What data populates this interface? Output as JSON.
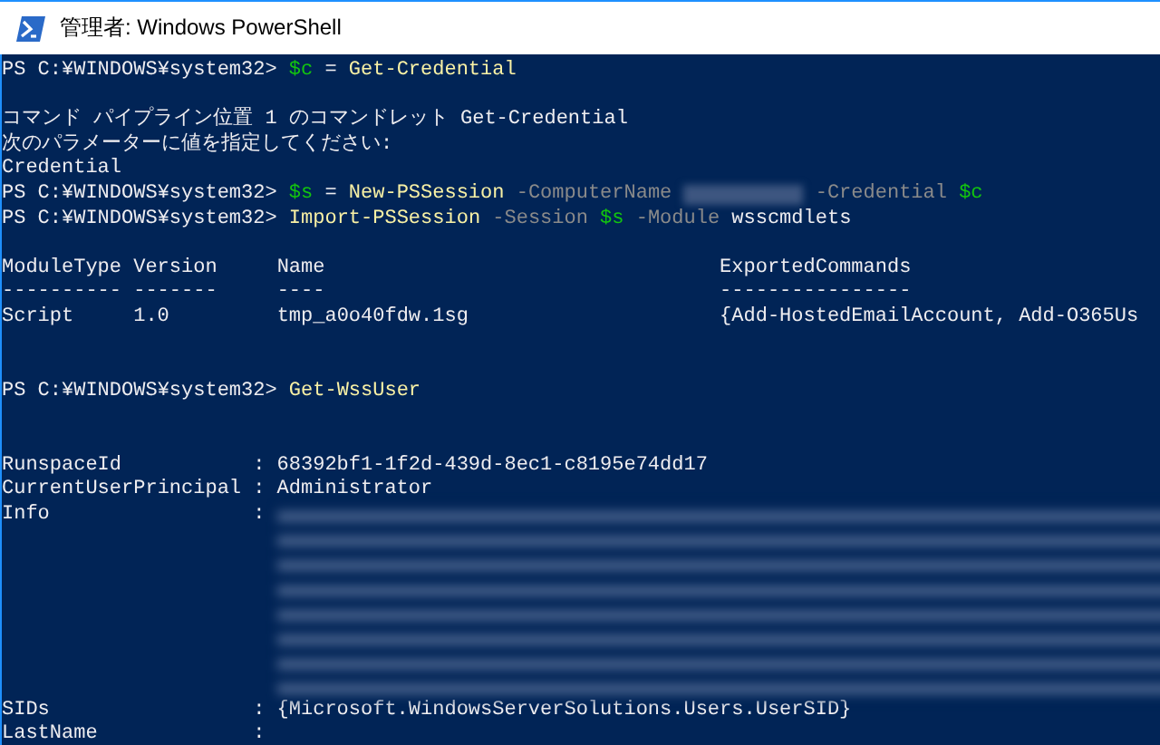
{
  "window": {
    "title": "管理者: Windows PowerShell"
  },
  "console": [
    {
      "kind": "line",
      "segments": [
        {
          "kind": "prompt",
          "text": "PS C:¥WINDOWS¥system32>"
        },
        {
          "kind": "var",
          "text": "$c"
        },
        {
          "kind": "text",
          "text": "="
        },
        {
          "kind": "cmd",
          "text": "Get-Credential"
        }
      ]
    },
    {
      "kind": "blank"
    },
    {
      "kind": "line",
      "segments": [
        {
          "kind": "text",
          "text": "コマンド パイプライン位置 1 のコマンドレット Get-Credential"
        }
      ]
    },
    {
      "kind": "line",
      "segments": [
        {
          "kind": "text",
          "text": "次のパラメーターに値を指定してください:"
        }
      ]
    },
    {
      "kind": "line",
      "segments": [
        {
          "kind": "text",
          "text": "Credential"
        }
      ]
    },
    {
      "kind": "line",
      "segments": [
        {
          "kind": "prompt",
          "text": "PS C:¥WINDOWS¥system32>"
        },
        {
          "kind": "var",
          "text": "$s"
        },
        {
          "kind": "text",
          "text": "="
        },
        {
          "kind": "cmd",
          "text": "New-PSSession"
        },
        {
          "kind": "param",
          "text": "-ComputerName"
        },
        {
          "kind": "redacted"
        },
        {
          "kind": "param",
          "text": "-Credential"
        },
        {
          "kind": "var",
          "text": "$c"
        }
      ]
    },
    {
      "kind": "line",
      "segments": [
        {
          "kind": "prompt",
          "text": "PS C:¥WINDOWS¥system32>"
        },
        {
          "kind": "cmd",
          "text": "Import-PSSession"
        },
        {
          "kind": "param",
          "text": "-Session"
        },
        {
          "kind": "var",
          "text": "$s"
        },
        {
          "kind": "param",
          "text": "-Module"
        },
        {
          "kind": "text",
          "text": "wsscmdlets"
        }
      ]
    },
    {
      "kind": "blank"
    },
    {
      "kind": "table",
      "columns": [
        "ModuleType",
        "Version",
        "Name",
        "ExportedCommands"
      ],
      "rules": [
        "----------",
        "-------",
        "----",
        "----------------"
      ],
      "rows": [
        [
          "Script",
          "1.0",
          "tmp_a0o40fdw.1sg",
          "{Add-HostedEmailAccount, Add-O365Us"
        ]
      ]
    },
    {
      "kind": "blank"
    },
    {
      "kind": "blank"
    },
    {
      "kind": "line",
      "segments": [
        {
          "kind": "prompt",
          "text": "PS C:¥WINDOWS¥system32>"
        },
        {
          "kind": "cmd",
          "text": "Get-WssUser"
        }
      ]
    },
    {
      "kind": "blank"
    },
    {
      "kind": "blank"
    },
    {
      "kind": "properties",
      "items": [
        {
          "name": "RunspaceId",
          "separator": ":",
          "kind": "text",
          "value": "68392bf1-1f2d-439d-8ec1-c8195e74dd17"
        },
        {
          "name": "CurrentUserPrincipal",
          "separator": ":",
          "kind": "text",
          "value": "Administrator"
        },
        {
          "name": "Info",
          "separator": ":",
          "kind": "redacted"
        },
        {
          "name": "SIDs",
          "separator": ":",
          "kind": "text",
          "value": "{Microsoft.WindowsServerSolutions.Users.UserSID}"
        },
        {
          "name": "LastName",
          "separator": ":",
          "kind": "empty"
        }
      ]
    }
  ]
}
